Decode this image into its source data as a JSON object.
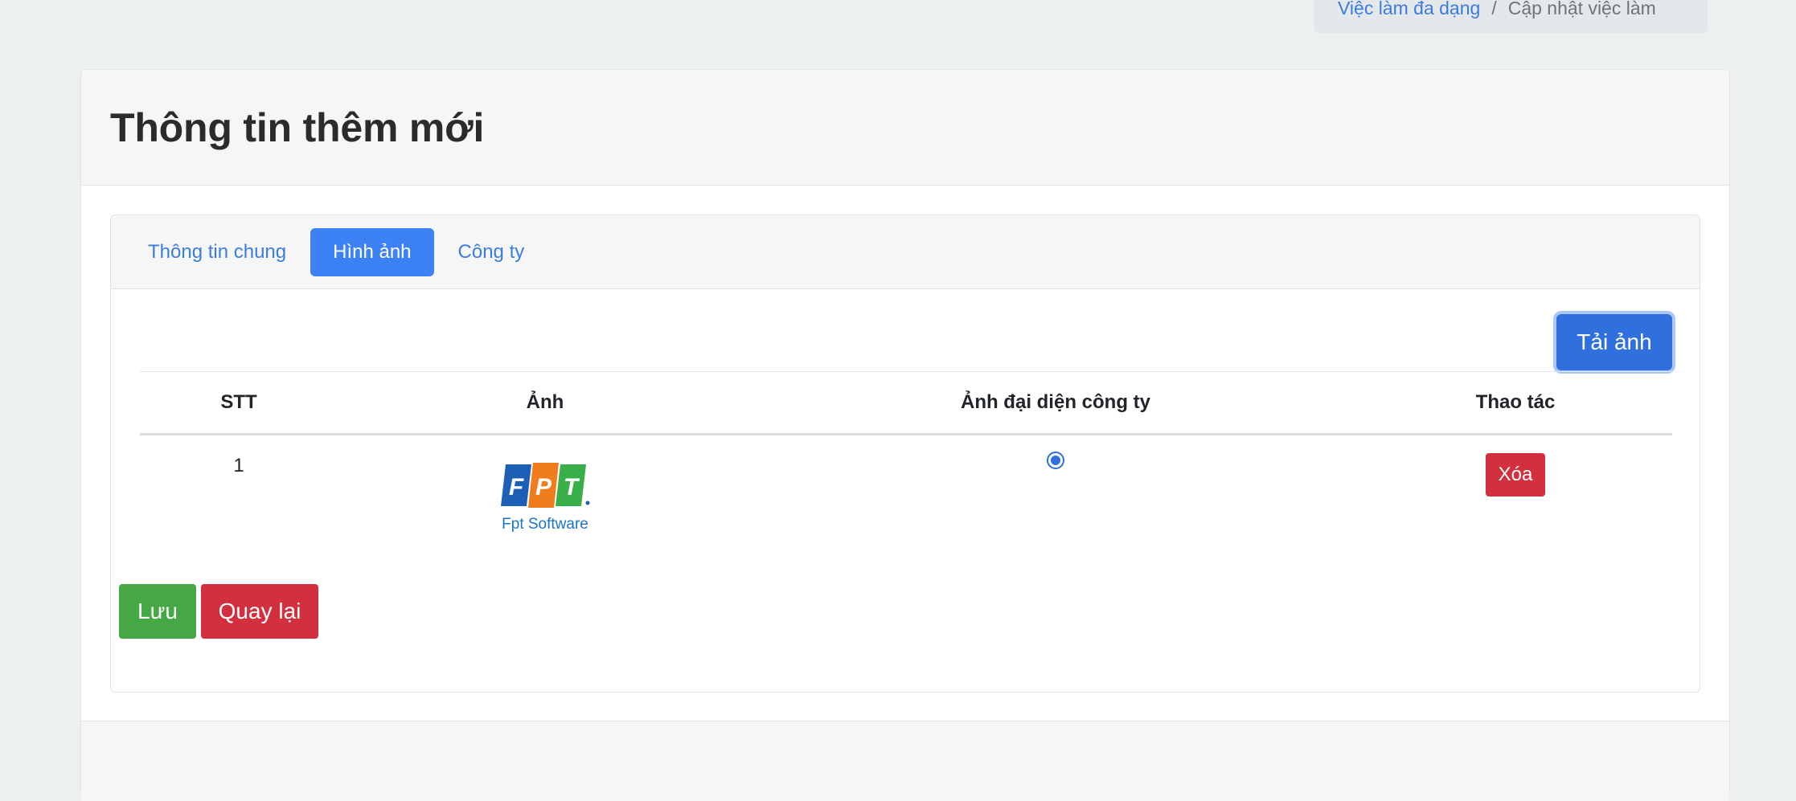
{
  "breadcrumb": {
    "items": [
      {
        "label": "Việc làm đa dạng"
      },
      {
        "label": "Cập nhật việc làm"
      }
    ],
    "separator": "/"
  },
  "card": {
    "title": "Thông tin thêm mới"
  },
  "tabs": [
    {
      "label": "Thông tin chung",
      "active": false
    },
    {
      "label": "Hình ảnh",
      "active": true
    },
    {
      "label": "Công ty",
      "active": false
    }
  ],
  "upload_button": "Tải ảnh",
  "table": {
    "headers": [
      "STT",
      "Ảnh",
      "Ảnh đại diện công ty",
      "Thao tác"
    ],
    "rows": [
      {
        "stt": "1",
        "image_caption": "Fpt Software",
        "image_letters": [
          "F",
          "P",
          "T"
        ],
        "is_avatar": true,
        "delete_label": "Xóa"
      }
    ]
  },
  "actions": {
    "save": "Lưu",
    "back": "Quay lại"
  },
  "colors": {
    "primary": "#3d82f5",
    "danger": "#d2303f",
    "success": "#45a845",
    "link": "#3b7ddd",
    "fpt_blue": "#1d5fb4",
    "fpt_orange": "#f07c1c",
    "fpt_green": "#3aae48"
  }
}
